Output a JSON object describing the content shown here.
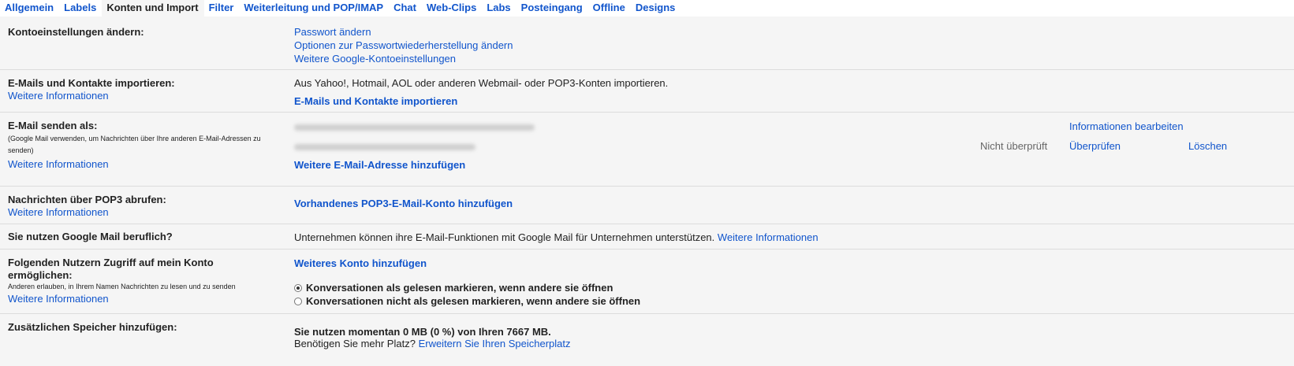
{
  "tabs": [
    {
      "label": "Allgemein",
      "active": false
    },
    {
      "label": "Labels",
      "active": false
    },
    {
      "label": "Konten und Import",
      "active": true
    },
    {
      "label": "Filter",
      "active": false
    },
    {
      "label": "Weiterleitung und POP/IMAP",
      "active": false
    },
    {
      "label": "Chat",
      "active": false
    },
    {
      "label": "Web-Clips",
      "active": false
    },
    {
      "label": "Labs",
      "active": false
    },
    {
      "label": "Posteingang",
      "active": false
    },
    {
      "label": "Offline",
      "active": false
    },
    {
      "label": "Designs",
      "active": false
    }
  ],
  "account": {
    "title": "Kontoeinstellungen ändern:",
    "links": [
      "Passwort ändern",
      "Optionen zur Passwortwiederherstellung ändern",
      "Weitere Google-Kontoeinstellungen"
    ]
  },
  "import": {
    "title": "E-Mails und Kontakte importieren:",
    "more": "Weitere Informationen",
    "desc": "Aus Yahoo!, Hotmail, AOL oder anderen Webmail- oder POP3-Konten importieren.",
    "action": "E-Mails und Kontakte importieren"
  },
  "sendas": {
    "title": "E-Mail senden als:",
    "note": "(Google Mail verwenden, um Nachrichten über Ihre anderen E-Mail-Adressen zu senden)",
    "more": "Weitere Informationen",
    "edit": "Informationen bearbeiten",
    "status": "Nicht überprüft",
    "verify": "Überprüfen",
    "delete": "Löschen",
    "add": "Weitere E-Mail-Adresse hinzufügen"
  },
  "pop3": {
    "title": "Nachrichten über POP3 abrufen:",
    "more": "Weitere Informationen",
    "action": "Vorhandenes POP3-E-Mail-Konto hinzufügen"
  },
  "business": {
    "title": "Sie nutzen Google Mail beruflich?",
    "desc": "Unternehmen können ihre E-Mail-Funktionen mit Google Mail für Unternehmen unterstützen.",
    "more": "Weitere Informationen"
  },
  "delegate": {
    "title": "Folgenden Nutzern Zugriff auf mein Konto ermöglichen:",
    "note": "Anderen erlauben, in Ihrem Namen Nachrichten zu lesen und zu senden",
    "more": "Weitere Informationen",
    "add": "Weiteres Konto hinzufügen",
    "opt1": "Konversationen als gelesen markieren, wenn andere sie öffnen",
    "opt2": "Konversationen nicht als gelesen markieren, wenn andere sie öffnen"
  },
  "storage": {
    "title": "Zusätzlichen Speicher hinzufügen:",
    "usage": "Sie nutzen momentan 0 MB (0 %) von Ihren 7667 MB.",
    "question": "Benötigen Sie mehr Platz?",
    "link": "Erweitern Sie Ihren Speicherplatz"
  }
}
